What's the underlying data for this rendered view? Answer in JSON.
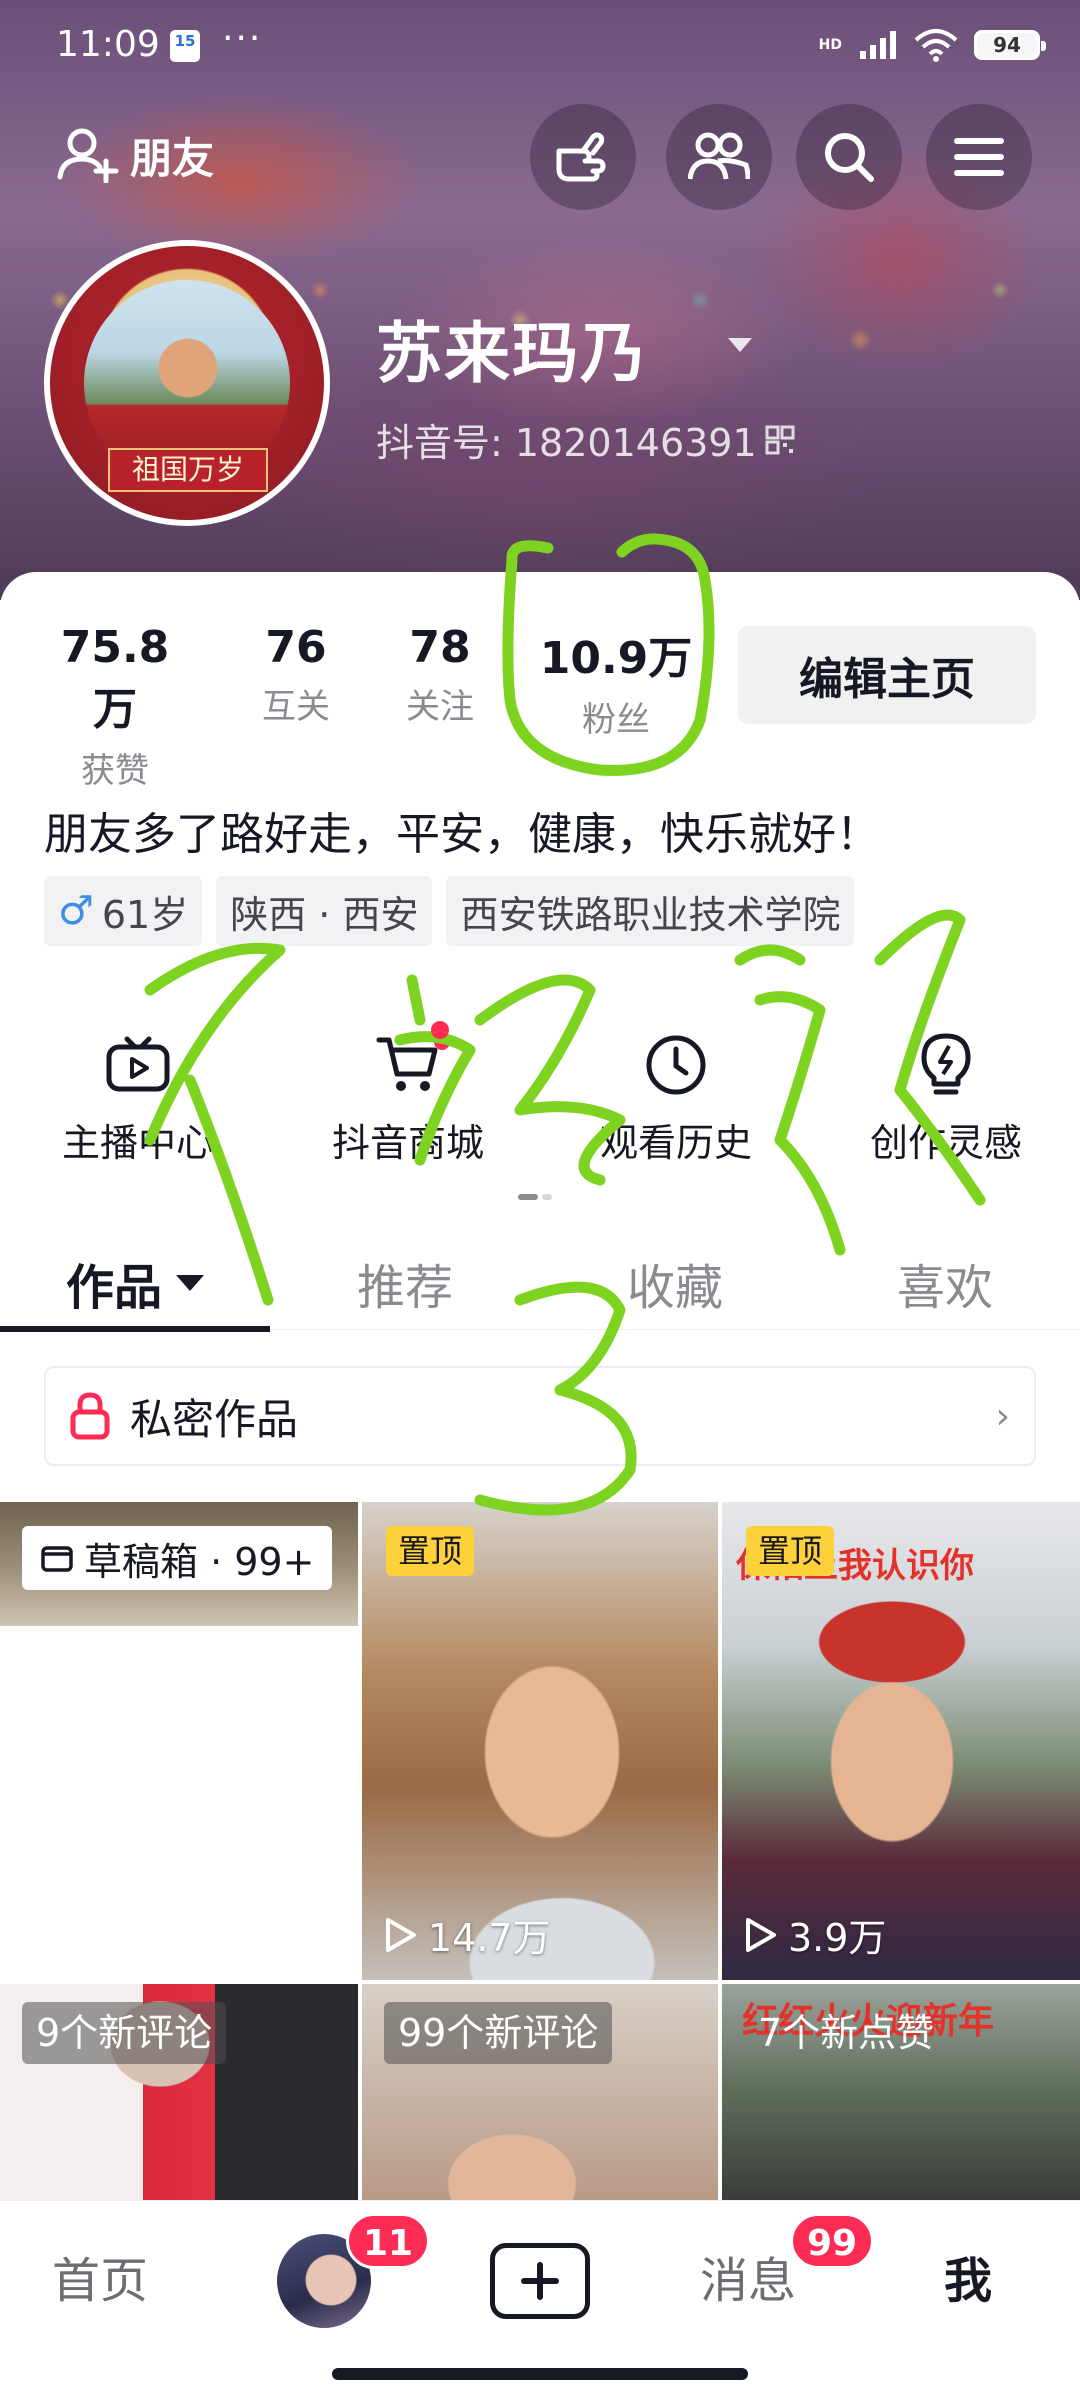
{
  "status_bar": {
    "time": "11:09",
    "calendar_day": "15",
    "more": "···",
    "network": "HD",
    "battery": "94"
  },
  "top_nav": {
    "friends_label": "朋友",
    "icons": [
      "hand-pointer-icon",
      "users-icon",
      "search-icon",
      "menu-icon"
    ]
  },
  "profile": {
    "avatar_banner": "祖国万岁",
    "nickname": "苏来玛乃",
    "douyin_id": "抖音号: 1820146391"
  },
  "stats": [
    {
      "value": "75.8万",
      "label": "获赞"
    },
    {
      "value": "76",
      "label": "互关"
    },
    {
      "value": "78",
      "label": "关注"
    },
    {
      "value": "10.9万",
      "label": "粉丝"
    }
  ],
  "edit_button": "编辑主页",
  "bio": "朋友多了路好走，平安，健康，快乐就好！",
  "tags": {
    "age": "61岁",
    "location": "陕西 · 西安",
    "school": "西安铁路职业技术学院"
  },
  "tools": [
    {
      "icon": "live-play-icon",
      "label": "主播中心"
    },
    {
      "icon": "cart-icon",
      "label": "抖音商城"
    },
    {
      "icon": "clock-icon",
      "label": "观看历史"
    },
    {
      "icon": "bulb-icon",
      "label": "创作灵感"
    }
  ],
  "tabs": [
    "作品",
    "推荐",
    "收藏",
    "喜欢"
  ],
  "private_works": "私密作品",
  "grid": {
    "drafts": "草稿箱 · 99+",
    "pinned_label": "置顶",
    "video1_views": "14.7万",
    "video2_views": "3.9万",
    "video2_caption": "保佑上我认识你",
    "row2": [
      "9个新评论",
      "99个新评论",
      "7个新点赞"
    ],
    "row2_caption": "红红火火迎新年"
  },
  "bottom_nav": {
    "home": "首页",
    "friends_badge": "11",
    "messages": "消息",
    "messages_badge": "99",
    "me": "我"
  },
  "colors": {
    "accent": "#fe2c55",
    "pin": "#fdd13a",
    "annotation": "#7ed321"
  }
}
